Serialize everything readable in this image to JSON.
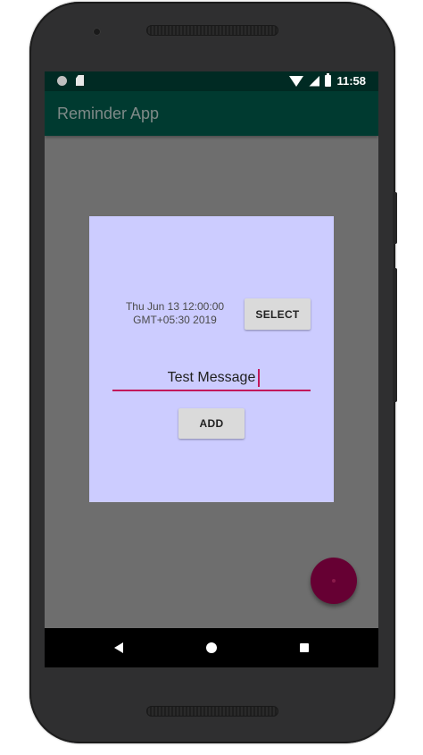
{
  "status_bar": {
    "time": "11:58",
    "icons": [
      "circle-notification-icon",
      "sd-card-icon",
      "wifi-icon",
      "cell-signal-icon",
      "battery-icon"
    ]
  },
  "app_bar": {
    "title": "Reminder App"
  },
  "dialog": {
    "date_text": "Thu Jun 13 12:00:00 GMT+05:30 2019",
    "select_label": "SELECT",
    "message_value": "Test Message",
    "add_label": "ADD"
  },
  "colors": {
    "app_bar": "#003a30",
    "status_bar": "#002a23",
    "dialog_bg": "#ccccff",
    "accent": "#c2185b",
    "fab": "#660033"
  },
  "nav": {
    "icons": [
      "back-icon",
      "home-icon",
      "recents-icon"
    ]
  }
}
